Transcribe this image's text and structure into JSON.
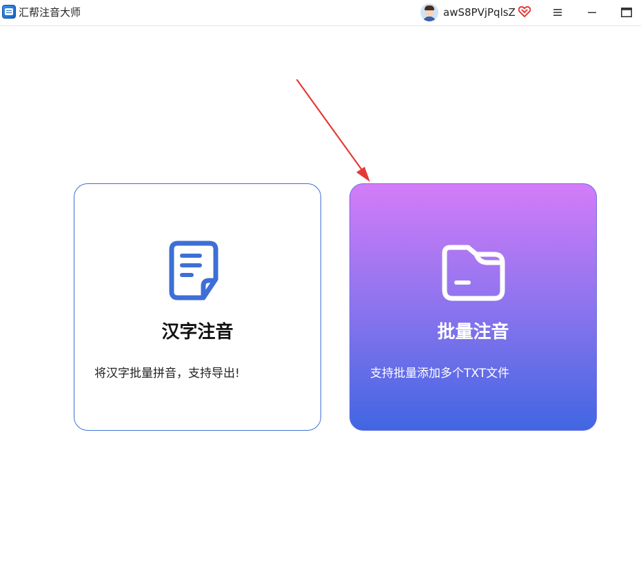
{
  "window": {
    "title": "汇帮注音大师",
    "username": "awS8PVjPqlsZ",
    "icons": {
      "app_logo": "app-logo-icon",
      "avatar": "user-avatar",
      "vip": "vip-heart-icon",
      "menu": "hamburger-menu-icon",
      "minimize": "minimize-icon",
      "maximize": "maximize-icon"
    }
  },
  "cards": [
    {
      "title": "汉字注音",
      "description": "将汉字批量拼音，支持导出!",
      "icon": "document-icon"
    },
    {
      "title": "批量注音",
      "description": "支持批量添加多个TXT文件",
      "icon": "folder-icon"
    }
  ],
  "colors": {
    "primary_blue": "#3d6fd6",
    "gradient_top": "#d47cf8",
    "gradient_bottom": "#4166e2",
    "arrow_red": "#e53935",
    "vip_red": "#e53935"
  }
}
